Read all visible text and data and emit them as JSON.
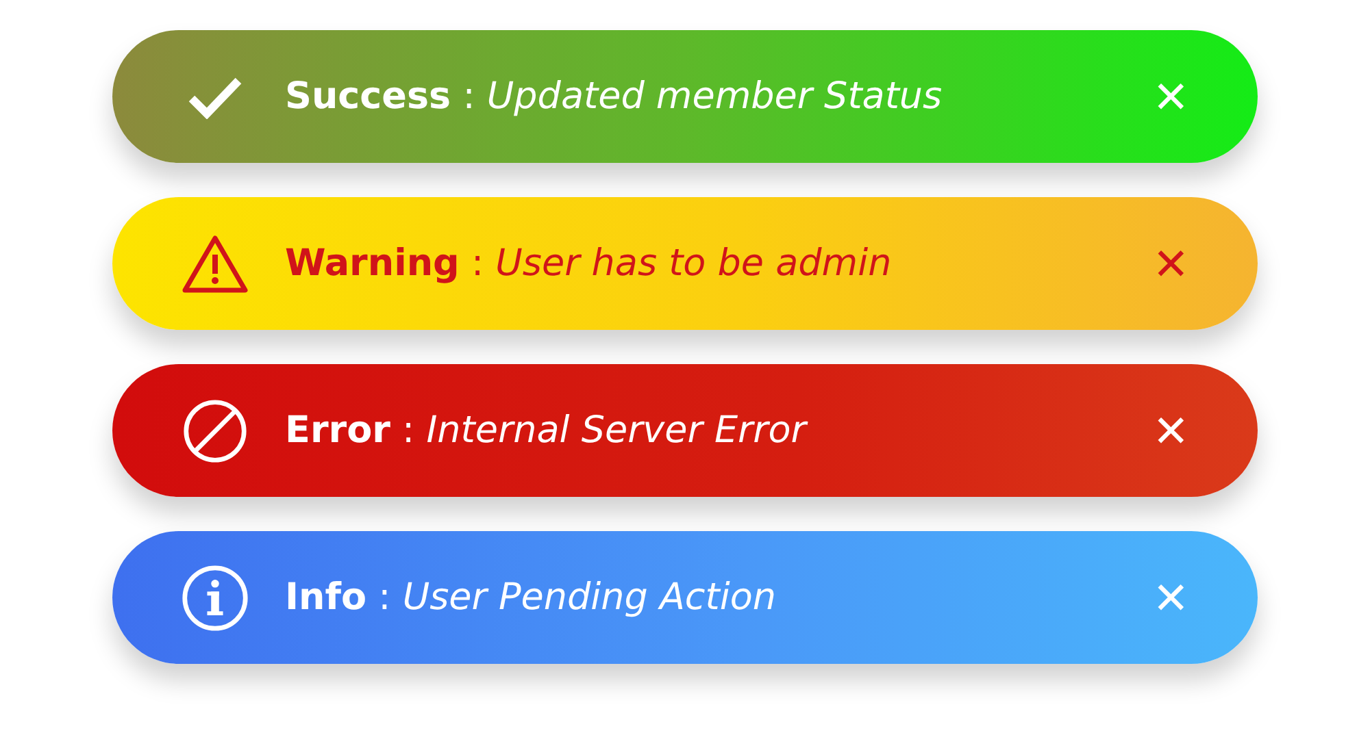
{
  "alerts": [
    {
      "kind": "success",
      "text": "**Success** : *Updated member Status*",
      "close": "✕"
    },
    {
      "kind": "warning",
      "text": "**Warning** : *User has to be admin*",
      "close": "✕"
    },
    {
      "kind": "error",
      "text": "**Error** : *Internal Server Error*",
      "close": "✕"
    },
    {
      "kind": "info",
      "text": "**Info** : *User Pending Action*",
      "close": "✕"
    }
  ]
}
